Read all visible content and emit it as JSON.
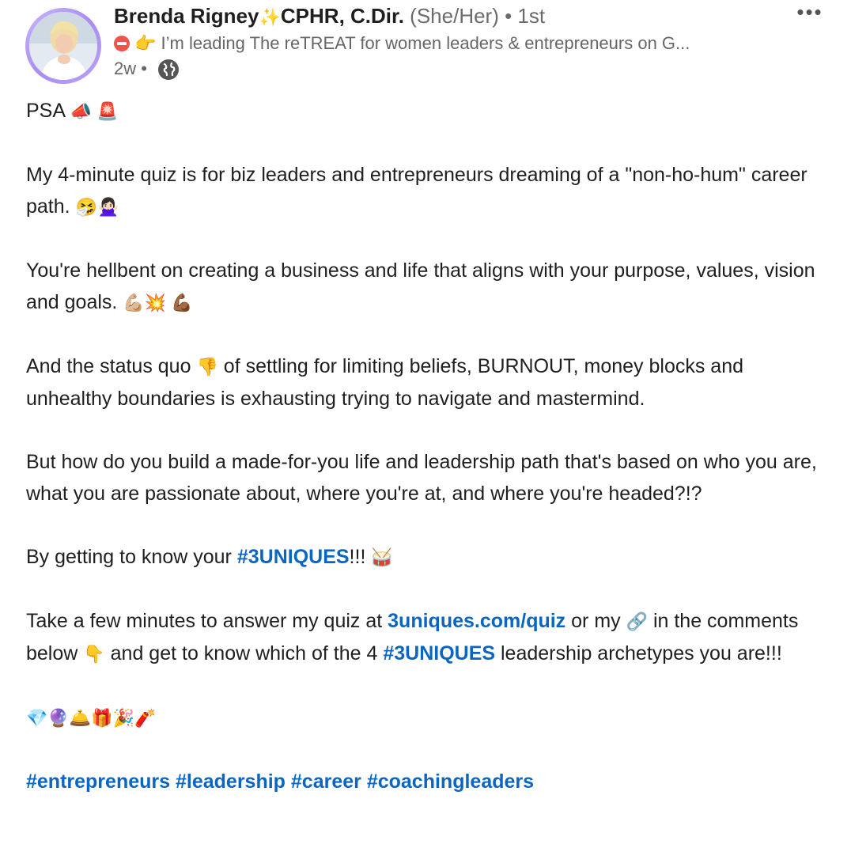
{
  "author": {
    "name": "Brenda Rigney",
    "sparkle": "✨",
    "credentials": "CPHR, C.Dir.",
    "pronouns": "(She/Her)",
    "connection": "• 1st",
    "headline": "👉 I’m leading The reTREAT for women leaders & entrepreneurs on G...",
    "time": "2w •"
  },
  "menu": {
    "dots": "•••"
  },
  "body": {
    "p1_text": "PSA",
    "p1_emoji": "📣 🚨",
    "p2_text": "My 4-minute quiz is for biz leaders and entrepreneurs dreaming of a \"non-ho-hum\" career path.",
    "p2_emoji": "🤧🙅🏻‍♀️",
    "p3_text": "You're hellbent on creating a business and life that aligns with your purpose, values, vision and goals.",
    "p3_emoji": "💪🏼💥 💪🏾",
    "p4_a": "And the status quo",
    "p4_emoji": "👎",
    "p4_b": "of settling for limiting beliefs, BURNOUT, money blocks and unhealthy boundaries is exhausting trying to navigate and mastermind.",
    "p5_text": "But how do you build a made-for-you life and leadership path that's based on who you are, what you are passionate about, where you're at, and where you're headed?!?",
    "p6_a": "By getting to know your",
    "p6_link": "#3UNIQUES",
    "p6_b": "!!!",
    "p6_emoji": "🥁",
    "p7_a": "Take a few minutes to answer my quiz at",
    "p7_link": "3uniques.com/quiz",
    "p7_b": "or my",
    "p7_emoji1": "🔗",
    "p7_c": "in the comments below",
    "p7_emoji2": "👇",
    "p7_d": "and get to know which of the 4",
    "p7_link2": "#3UNIQUES",
    "p7_e": "leadership archetypes you are!!!",
    "p8_emoji": "💎🔮🛎️🎁🎉🧨"
  },
  "hashtags": [
    "#entrepreneurs",
    "#leadership",
    "#career",
    "#coachingleaders"
  ],
  "colors": {
    "link": "#0a66c2",
    "text": "#1f1f1f",
    "muted": "#666666",
    "avatar_ring": "#b7a2f7"
  }
}
